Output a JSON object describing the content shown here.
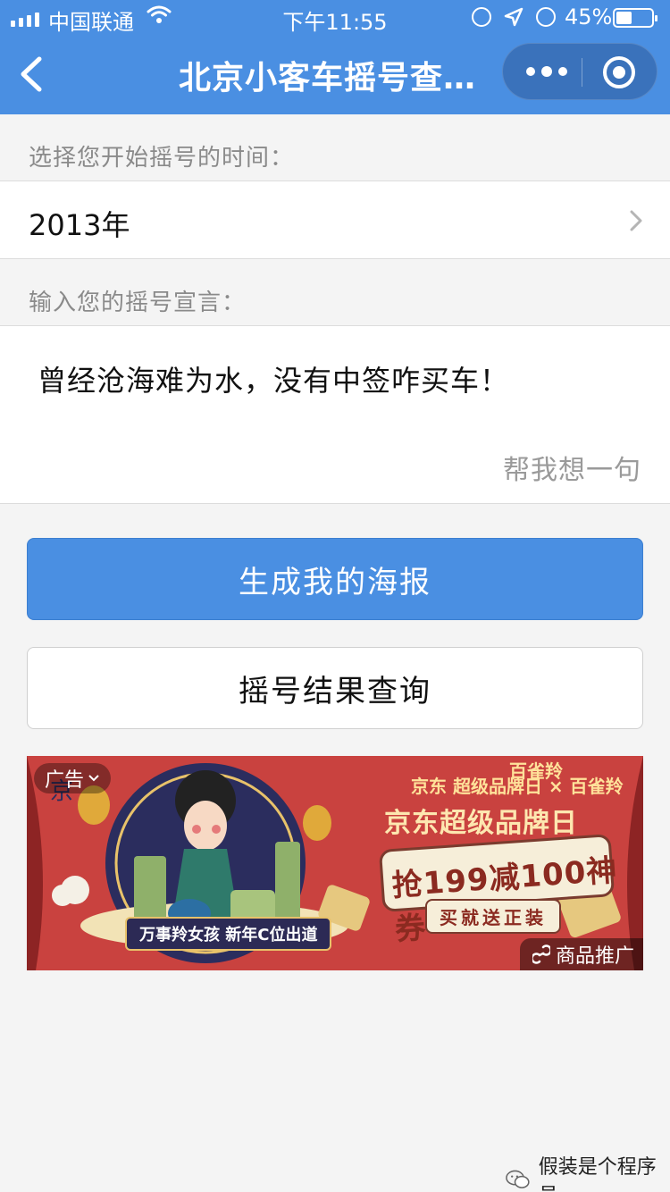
{
  "status_bar": {
    "carrier": "中国联通",
    "time": "下午11:55",
    "battery": "45%",
    "battery_level": 0.45
  },
  "nav": {
    "title": "北京小客车摇号查…"
  },
  "form": {
    "start_time_label": "选择您开始摇号的时间：",
    "start_year": "2013年",
    "declaration_label": "输入您的摇号宣言：",
    "declaration_text": "曾经沧海难为水，没有中签咋买车！",
    "suggest_label": "帮我想一句"
  },
  "buttons": {
    "generate_poster": "生成我的海报",
    "query_result": "摇号结果查询"
  },
  "ad": {
    "tag": "广告",
    "brand": "京东 超级品牌日 × 百雀羚",
    "headline": "京东超级品牌日",
    "coupon": "抢199减100神券",
    "subline": "买就送正装",
    "tagline": "万事羚女孩 新年C位出道",
    "promo_label": "商品推广"
  },
  "watermark": {
    "text": "假装是个程序员"
  },
  "colors": {
    "primary": "#4a8fe2",
    "background": "#f4f4f4",
    "ad_red": "#c9423f"
  }
}
